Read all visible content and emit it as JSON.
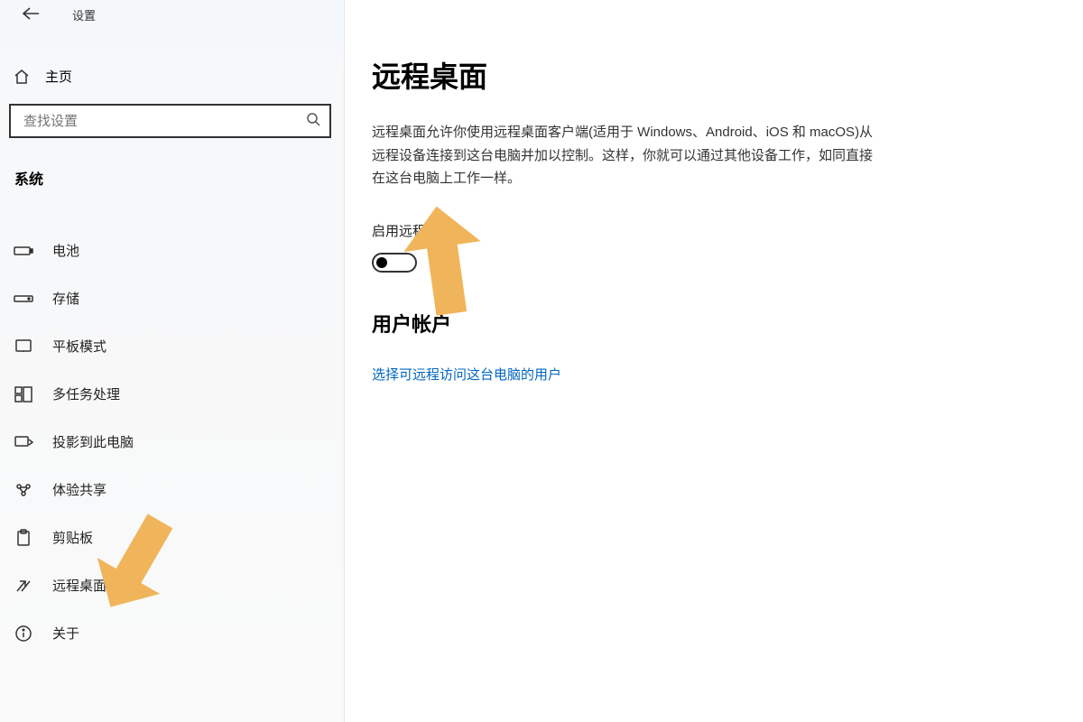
{
  "topbar": {
    "title": "设置"
  },
  "home": {
    "label": "主页"
  },
  "search": {
    "placeholder": "查找设置"
  },
  "category": {
    "label": "系统"
  },
  "sidebar": {
    "items": [
      {
        "label": "电池"
      },
      {
        "label": "存储"
      },
      {
        "label": "平板模式"
      },
      {
        "label": "多任务处理"
      },
      {
        "label": "投影到此电脑"
      },
      {
        "label": "体验共享"
      },
      {
        "label": "剪贴板"
      },
      {
        "label": "远程桌面"
      },
      {
        "label": "关于"
      }
    ]
  },
  "main": {
    "title": "远程桌面",
    "description": "远程桌面允许你使用远程桌面客户端(适用于 Windows、Android、iOS 和 macOS)从远程设备连接到这台电脑并加以控制。这样，你就可以通过其他设备工作，如同直接在这台电脑上工作一样。",
    "enable_label": "启用远程桌面",
    "toggle_state": "关",
    "section_sub": "用户帐户",
    "link_text": "选择可远程访问这台电脑的用户"
  }
}
